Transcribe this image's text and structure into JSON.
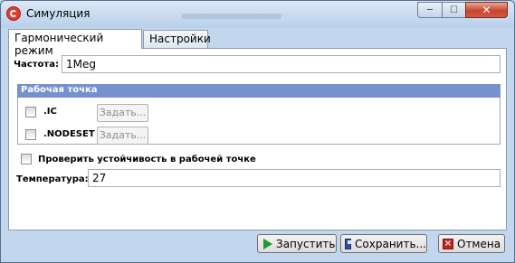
{
  "window": {
    "title": "Симуляция",
    "close_symbol": "✕",
    "min_symbol": "─",
    "max_symbol": "☐"
  },
  "tabs": [
    {
      "label": "Гармонический режим",
      "active": true
    },
    {
      "label": "Настройки",
      "active": false
    }
  ],
  "frequency": {
    "label": "Частота:",
    "value": "1Meg"
  },
  "operating_point": {
    "header": "Рабочая точка",
    "items": [
      {
        "label": ".IC",
        "checked": false,
        "button": "Задать..."
      },
      {
        "label": ".NODESET",
        "checked": false,
        "button": "Задать..."
      }
    ]
  },
  "stability": {
    "label": "Проверить устойчивость в рабочей точке",
    "checked": false
  },
  "temperature": {
    "label": "Температура:",
    "value": "27"
  },
  "buttons": {
    "run": "Запустить",
    "save": "Сохранить...",
    "cancel": "Отмена"
  },
  "colors": {
    "group_header": "#7592cf",
    "run_icon": "#1e9a2e",
    "cancel_icon": "#c9201a",
    "save_icon": "#2d4fa0"
  },
  "icons": [
    "app-logo-icon",
    "minimize-icon",
    "maximize-icon",
    "close-icon",
    "play-icon",
    "save-icon",
    "cancel-x-icon"
  ]
}
